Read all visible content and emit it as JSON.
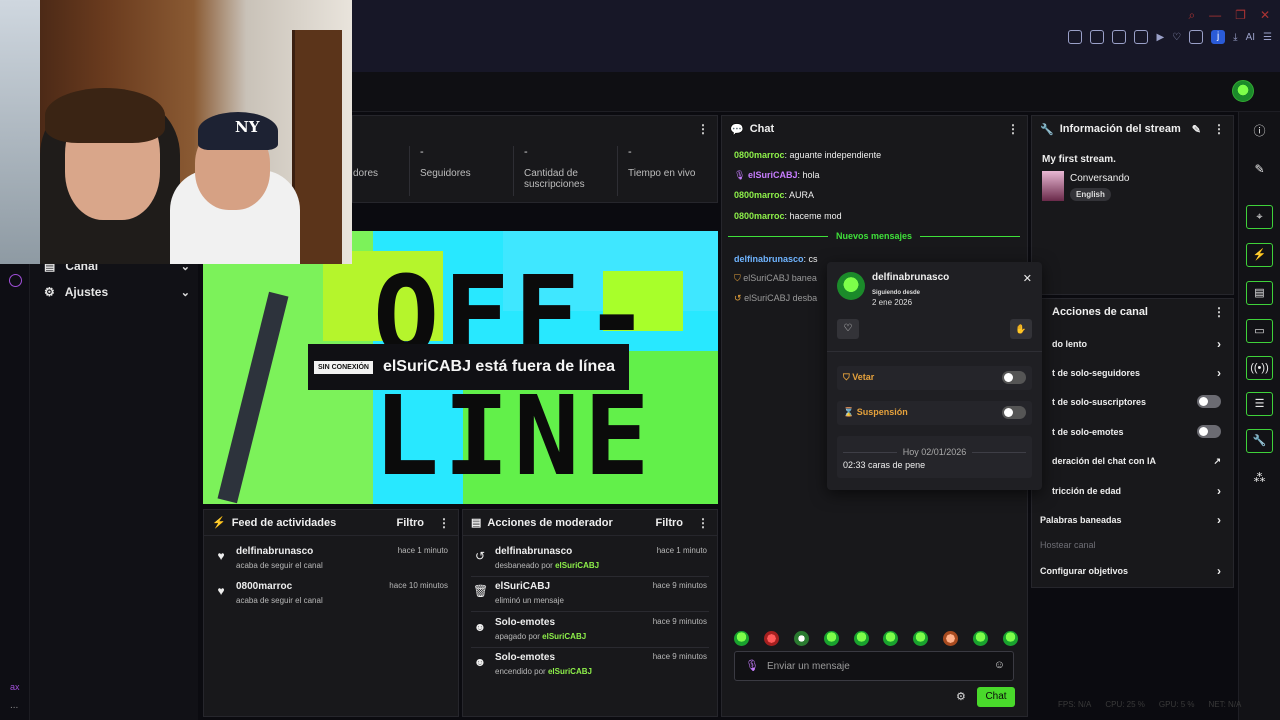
{
  "browser": {
    "ext_label": "AI"
  },
  "sidebar": {
    "items": [
      {
        "label": "Canal",
        "icon": "channel-icon"
      },
      {
        "label": "Ajustes",
        "icon": "gear-icon"
      }
    ],
    "bottom_label": "ax"
  },
  "stats": {
    "items": [
      {
        "value": "",
        "label": "dores"
      },
      {
        "value": "-",
        "label": "Seguidores"
      },
      {
        "value": "-",
        "label": "Cantidad de suscripciones"
      },
      {
        "value": "-",
        "label": "Tiempo en vivo"
      }
    ]
  },
  "video": {
    "badge": "SIN CONEXIÓN",
    "status_text": "elSuriCABJ está fuera de línea",
    "big_top": "OFF-",
    "big_bottom": "LINE"
  },
  "activity_feed": {
    "title": "Feed de actividades",
    "filter": "Filtro",
    "rows": [
      {
        "name": "delfinabrunasco",
        "sub": "acaba de seguir el canal",
        "time": "hace 1 minuto",
        "icon": "heart-icon"
      },
      {
        "name": "0800marroc",
        "sub": "acaba de seguir el canal",
        "time": "hace 10 minutos",
        "icon": "heart-icon"
      }
    ]
  },
  "mod_actions": {
    "title": "Acciones de moderador",
    "filter": "Filtro",
    "rows": [
      {
        "name": "delfinabrunasco",
        "sub_prefix": "desbaneado por ",
        "sub_user": "elSuriCABJ",
        "time": "hace 1 minuto",
        "icon": "undo-icon"
      },
      {
        "name": "elSuriCABJ",
        "sub_prefix": "eliminó un mensaje",
        "sub_user": "",
        "time": "hace 9 minutos",
        "icon": "trash-icon"
      },
      {
        "name": "Solo-emotes",
        "sub_prefix": "apagado por ",
        "sub_user": "elSuriCABJ",
        "time": "hace 9 minutos",
        "icon": "emote-icon"
      },
      {
        "name": "Solo-emotes",
        "sub_prefix": "encendido por ",
        "sub_user": "elSuriCABJ",
        "time": "hace 9 minutos",
        "icon": "emote-icon"
      }
    ]
  },
  "chat": {
    "title": "Chat",
    "messages": [
      {
        "user": "0800marroc",
        "text": ": aguante independiente",
        "color": "#8ef04a"
      },
      {
        "user": "elSuriCABJ",
        "text": ": hola",
        "color": "#c77dff"
      },
      {
        "user": "0800marroc",
        "text": ": AURA",
        "color": "#8ef04a"
      },
      {
        "user": "0800marroc",
        "text": ": haceme mod",
        "color": "#8ef04a"
      }
    ],
    "new_messages": "Nuevos mensajes",
    "after": [
      {
        "user": "delfinabrunasco",
        "text": ": cs",
        "color": "#6fb4ff"
      },
      {
        "user": "elSuriCABJ",
        "text": " banea",
        "color": "#9a9a9a"
      },
      {
        "user": "elSuriCABJ",
        "text": " desba",
        "color": "#9a9a9a"
      }
    ],
    "input_placeholder": "Enviar un mensaje",
    "send_label": "Chat"
  },
  "user_card": {
    "name": "delfinabrunasco",
    "following_label": "Siguiendo desde",
    "following_date": "2 ene 2026",
    "ban_label": "Vetar",
    "timeout_label": "Suspensión",
    "date_divider": "Hoy 02/01/2026",
    "log_time": "02:33",
    "log_text": "caras de pene"
  },
  "stream_info": {
    "title": "Información del stream",
    "stream_title": "My first stream.",
    "category": "Conversando",
    "tag": "English"
  },
  "channel_actions": {
    "title": "Acciones de canal",
    "rows": [
      {
        "label": "do lento",
        "control": "chevron"
      },
      {
        "label": "t de solo-seguidores",
        "control": "chevron"
      },
      {
        "label": "t de solo-suscriptores",
        "control": "toggle"
      },
      {
        "label": "t de solo-emotes",
        "control": "toggle"
      },
      {
        "label": "deración del chat con IA",
        "control": "external"
      },
      {
        "label": "tricción de edad",
        "control": "chevron"
      },
      {
        "label": "Palabras baneadas",
        "control": "chevron"
      },
      {
        "label": "Hostear canal",
        "control": "none"
      },
      {
        "label": "Configurar objetivos",
        "control": "chevron"
      }
    ]
  },
  "footer": {
    "items": [
      "FPS: N/A",
      "CPU: 25 %",
      "GPU: 5 %",
      "NET: N/A"
    ]
  },
  "colors": {
    "accent_green": "#49d92b",
    "panel_bg": "#18181b",
    "purple": "#a04fd9"
  }
}
